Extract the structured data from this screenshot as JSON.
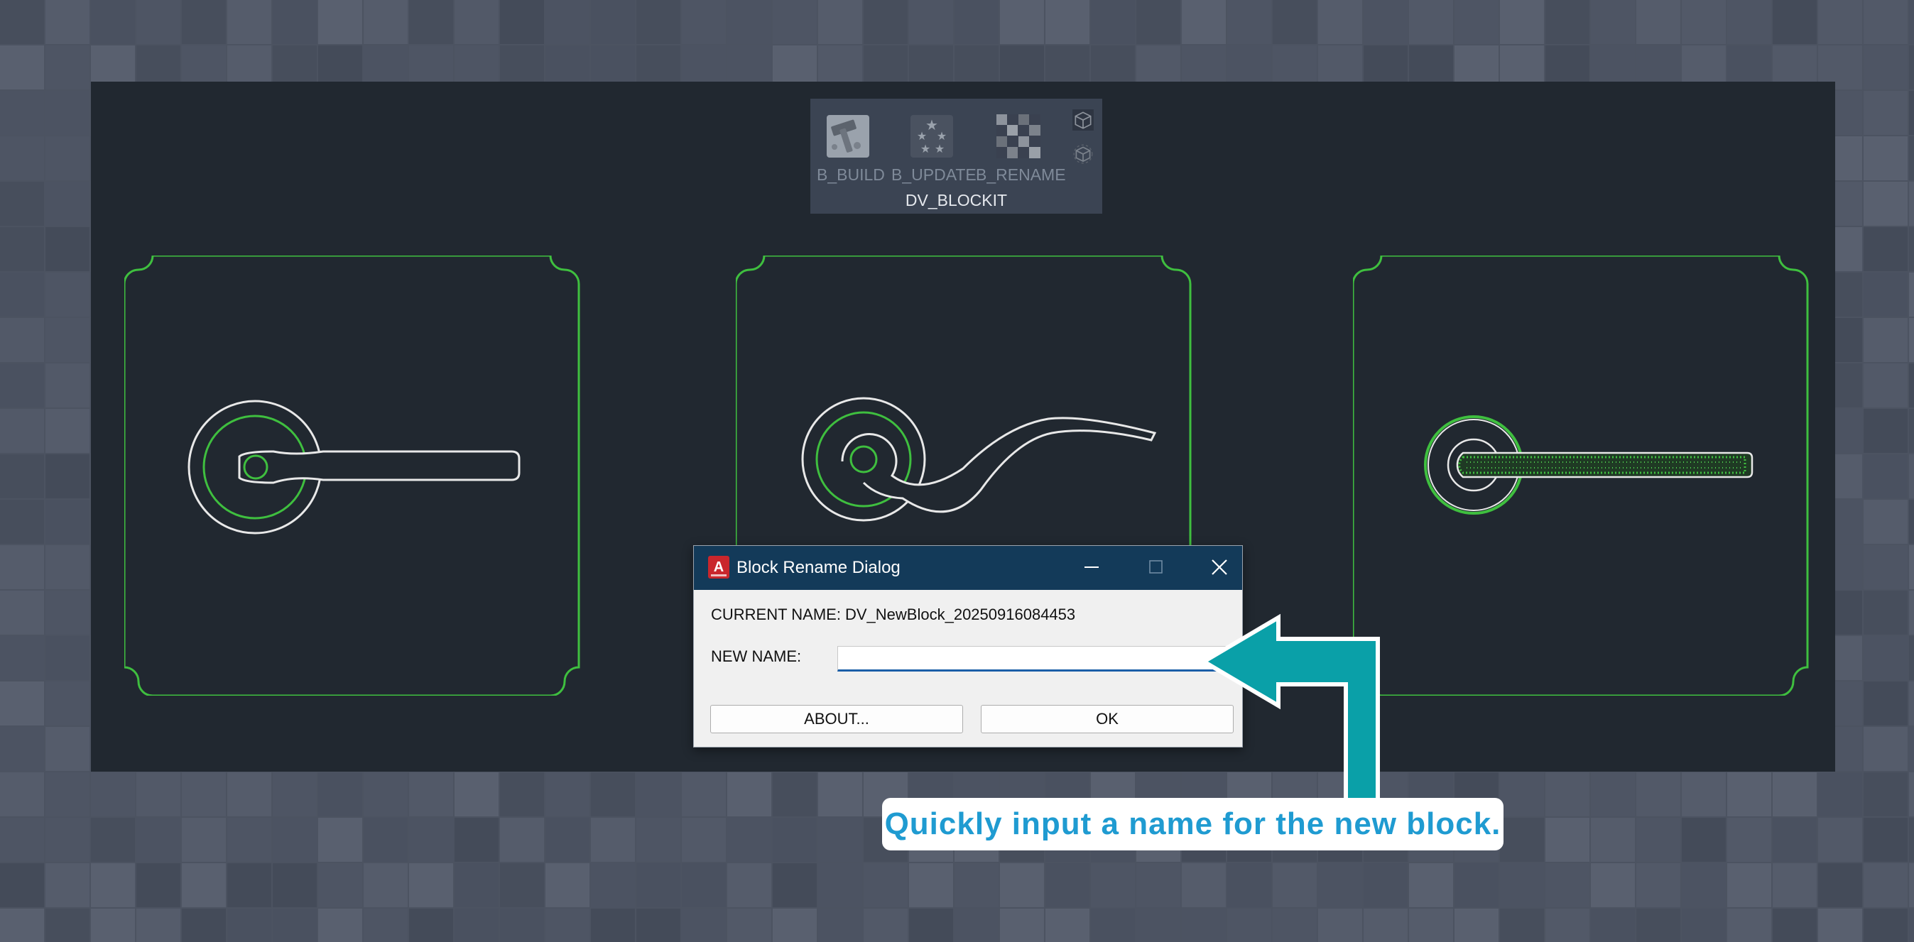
{
  "ribbon": {
    "buttons": [
      {
        "label": "B_BUILD",
        "icon": "hammer-icon"
      },
      {
        "label": "B_UPDATE",
        "icon": "stars-icon"
      },
      {
        "label": "B_RENAME",
        "icon": "checker-icon"
      }
    ],
    "small_icons": [
      "cube-icon",
      "cube-refresh-icon"
    ],
    "panel_title": "DV_BLOCKIT"
  },
  "drawing": {
    "cards": [
      "lever-handle-straight",
      "lever-handle-curved",
      "lever-handle-textured"
    ],
    "colors": {
      "frame": "#3fbf3f",
      "outline": "#e8e8e8",
      "canvas": "#212830"
    }
  },
  "dialog": {
    "title": "Block Rename Dialog",
    "current_name_label": "CURRENT NAME:",
    "current_name_value": "DV_NewBlock_20250916084453",
    "new_name_label": "NEW NAME:",
    "new_name_value": "",
    "about_button": "ABOUT...",
    "ok_button": "OK",
    "titlebar_color": "#133a59"
  },
  "callout": {
    "text": "Quickly input a name for the new block.",
    "arrow_color": "#0aa0a8",
    "text_color": "#1f9bd1"
  }
}
